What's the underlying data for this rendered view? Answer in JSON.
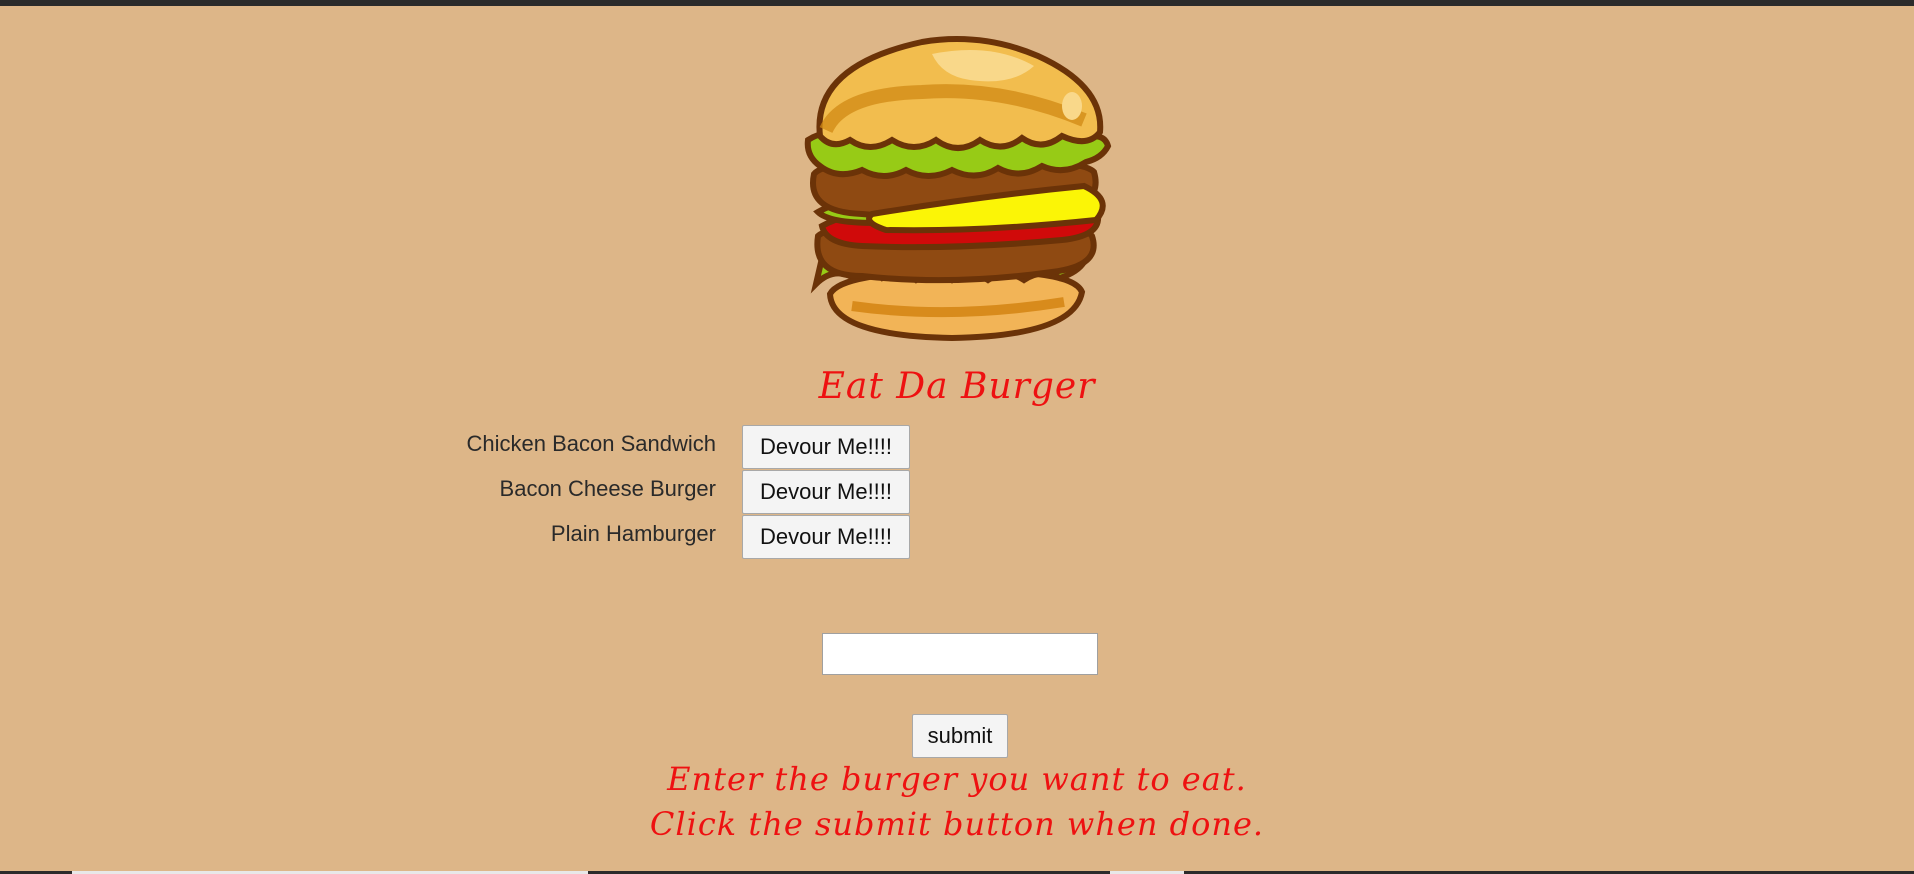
{
  "header": {
    "title": "Eat Da Burger",
    "logo_icon": "burger-logo-icon"
  },
  "burgers": [
    {
      "name": "Chicken Bacon Sandwich",
      "button_label": "Devour Me!!!!"
    },
    {
      "name": "Bacon Cheese Burger",
      "button_label": "Devour Me!!!!"
    },
    {
      "name": "Plain Hamburger",
      "button_label": "Devour Me!!!!"
    }
  ],
  "form": {
    "input_value": "",
    "submit_label": "submit"
  },
  "instructions": {
    "line1": "Enter the burger you want to eat.",
    "line2": "Click the submit button when done."
  },
  "colors": {
    "background": "#ddb688",
    "accent_text": "#ee1111"
  }
}
